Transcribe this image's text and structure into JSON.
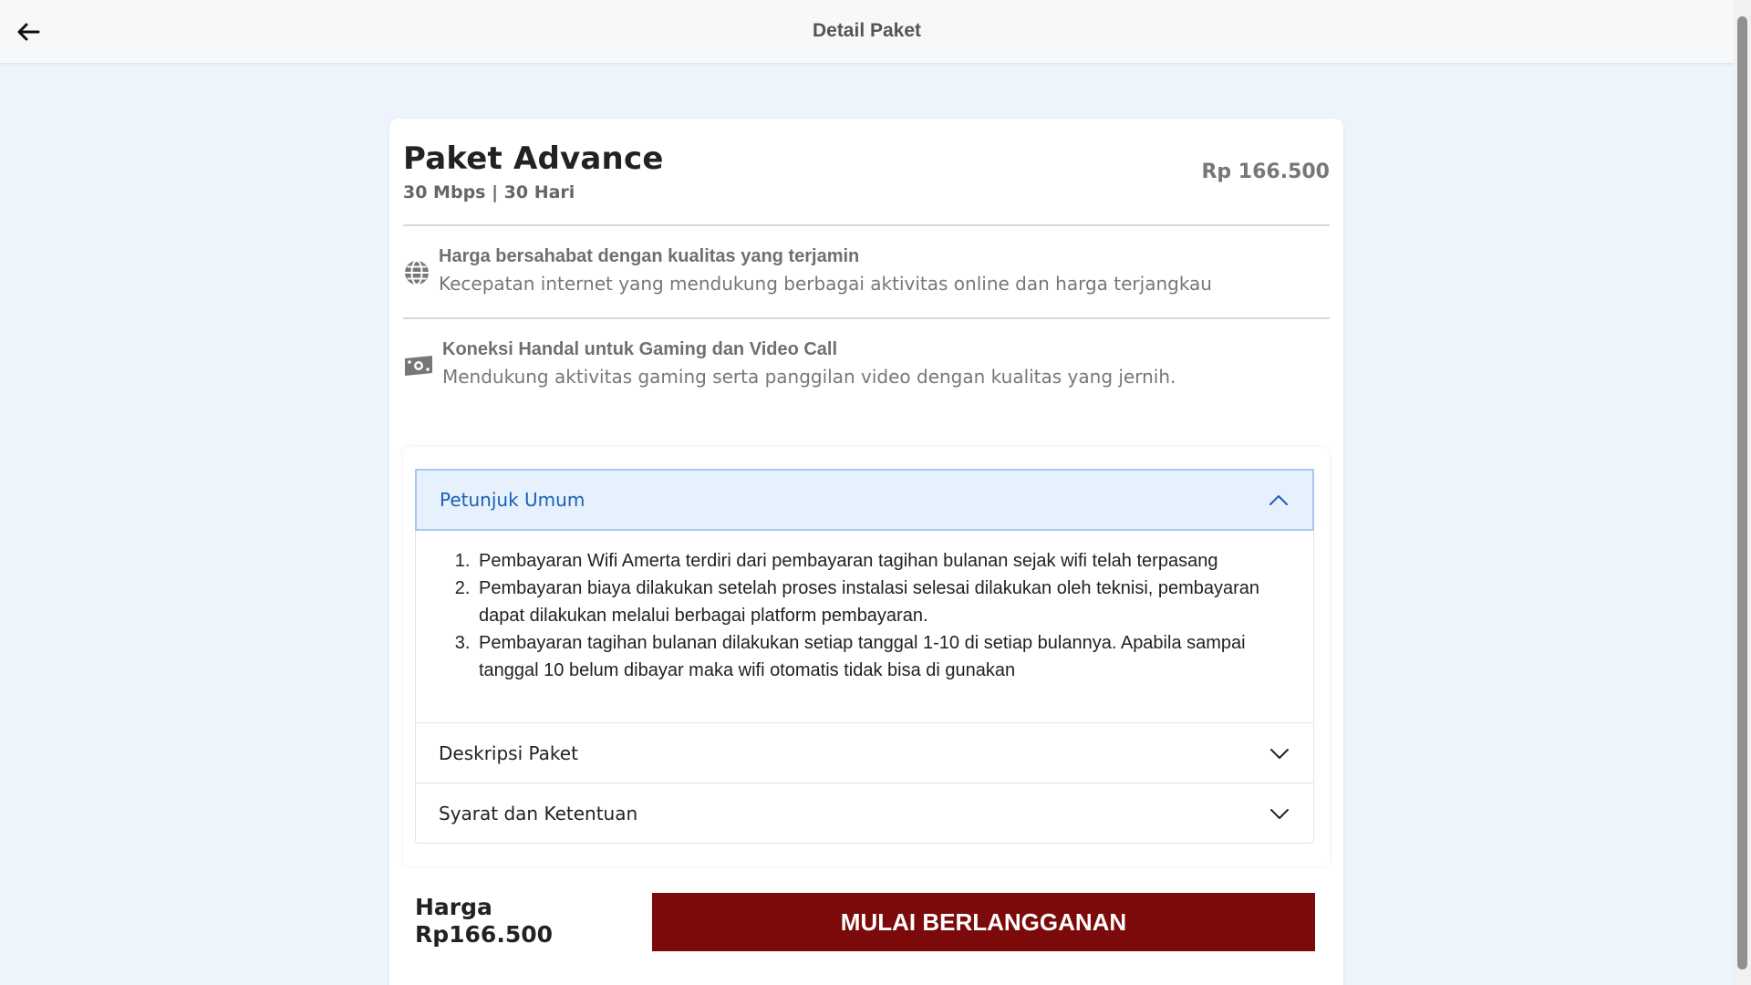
{
  "header": {
    "back_icon": "arrow-left-icon",
    "title": "Detail Paket"
  },
  "package": {
    "name": "Paket Advance",
    "subtitle": "30 Mbps | 30 Hari",
    "price": "Rp 166.500"
  },
  "features": [
    {
      "icon": "globe-icon",
      "title": "Harga bersahabat dengan kualitas yang terjamin",
      "description": "Kecepatan internet yang mendukung berbagai aktivitas online dan harga terjangkau"
    },
    {
      "icon": "money-icon",
      "title": "Koneksi Handal untuk Gaming dan Video Call",
      "description": "Mendukung aktivitas gaming serta panggilan video dengan kualitas yang jernih."
    }
  ],
  "accordion": {
    "sections": [
      {
        "title": "Petunjuk Umum",
        "expanded": true,
        "items": [
          "Pembayaran Wifi Amerta terdiri dari pembayaran tagihan bulanan sejak wifi telah terpasang",
          "Pembayaran biaya dilakukan setelah proses instalasi selesai dilakukan oleh teknisi, pembayaran dapat dilakukan melalui berbagai platform pembayaran.",
          "Pembayaran tagihan bulanan dilakukan setiap tanggal 1-10 di setiap bulannya. Apabila sampai tanggal 10 belum dibayar maka wifi otomatis tidak bisa di gunakan"
        ]
      },
      {
        "title": "Deskripsi Paket",
        "expanded": false
      },
      {
        "title": "Syarat dan Ketentuan",
        "expanded": false
      }
    ]
  },
  "footer": {
    "price_label": "Harga",
    "price_value": "Rp166.500",
    "subscribe_label": "MULAI BERLANGGANAN"
  },
  "colors": {
    "page_background": "#eef4fc",
    "accent_blue": "#1a5fb4",
    "subscribe_button": "#7d0a0a"
  }
}
